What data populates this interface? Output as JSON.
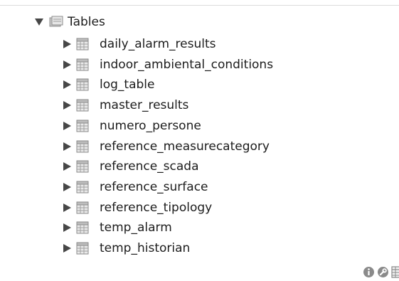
{
  "tree": {
    "group": {
      "label": "Tables",
      "expanded": true,
      "icon": "folder-icon"
    },
    "items": [
      {
        "label": "daily_alarm_results",
        "icon": "table-icon"
      },
      {
        "label": "indoor_ambiental_conditions",
        "icon": "table-icon"
      },
      {
        "label": "log_table",
        "icon": "table-icon"
      },
      {
        "label": "master_results",
        "icon": "table-icon"
      },
      {
        "label": "numero_persone",
        "icon": "table-icon"
      },
      {
        "label": "reference_measurecategory",
        "icon": "table-icon"
      },
      {
        "label": "reference_scada",
        "icon": "table-icon"
      },
      {
        "label": "reference_surface",
        "icon": "table-icon"
      },
      {
        "label": "reference_tipology",
        "icon": "table-icon"
      },
      {
        "label": "temp_alarm",
        "icon": "table-icon"
      },
      {
        "label": "temp_historian",
        "icon": "table-icon"
      }
    ],
    "row_actions": [
      "info-icon",
      "wrench-icon",
      "table-data-icon"
    ]
  },
  "colors": {
    "arrow": "#474747",
    "icon_gray": "#8a8a8a",
    "text": "#1c1c1c"
  }
}
